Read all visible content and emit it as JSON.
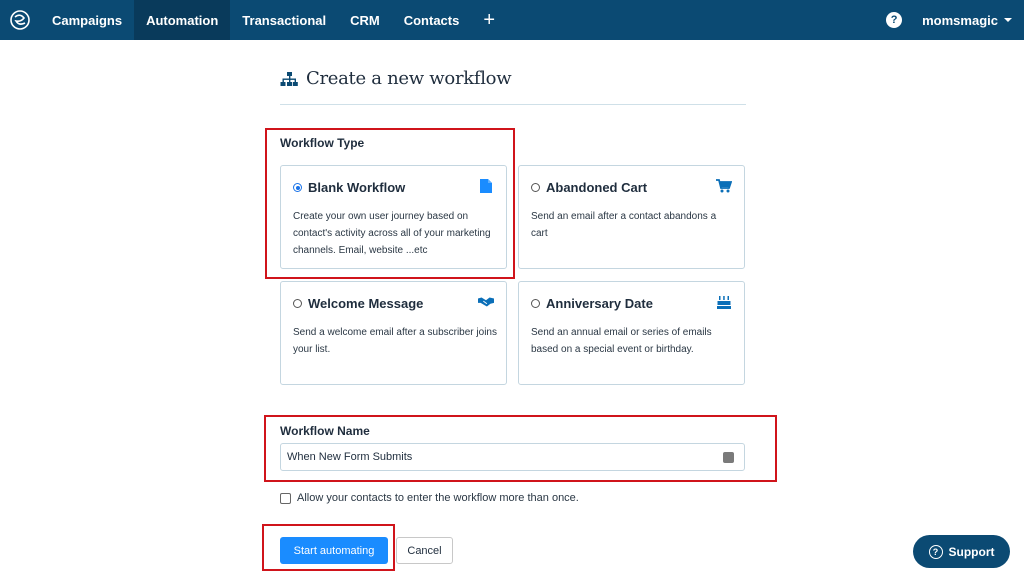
{
  "nav": {
    "items": [
      {
        "label": "Campaigns",
        "active": false
      },
      {
        "label": "Automation",
        "active": true
      },
      {
        "label": "Transactional",
        "active": false
      },
      {
        "label": "CRM",
        "active": false
      },
      {
        "label": "Contacts",
        "active": false
      }
    ],
    "plus_label": "+",
    "help_label": "?",
    "user_name": "momsmagic"
  },
  "page": {
    "title": "Create a new workflow",
    "workflow_type_label": "Workflow Type",
    "cards": [
      {
        "title": "Blank Workflow",
        "description": "Create your own user journey based on contact's activity across all of your marketing channels. Email, website ...etc",
        "selected": true,
        "icon": "document-icon"
      },
      {
        "title": "Abandoned Cart",
        "description": "Send an email after a contact abandons a cart",
        "selected": false,
        "icon": "cart-icon"
      },
      {
        "title": "Welcome Message",
        "description": "Send a welcome email after a subscriber joins your list.",
        "selected": false,
        "icon": "handshake-icon"
      },
      {
        "title": "Anniversary Date",
        "description": "Send an annual email or series of emails based on a special event or birthday.",
        "selected": false,
        "icon": "cake-icon"
      }
    ],
    "workflow_name_label": "Workflow Name",
    "workflow_name_value": "When New Form Submits",
    "reentry_label": "Allow your contacts to enter the workflow more than once.",
    "start_button": "Start automating",
    "cancel_button": "Cancel"
  },
  "support": {
    "label": "Support",
    "icon_label": "?"
  },
  "colors": {
    "nav_bg": "#0b4a73",
    "nav_active": "#093a5b",
    "primary": "#1a8cff",
    "radio_active": "#1a73e8",
    "highlight": "#d0141b"
  }
}
